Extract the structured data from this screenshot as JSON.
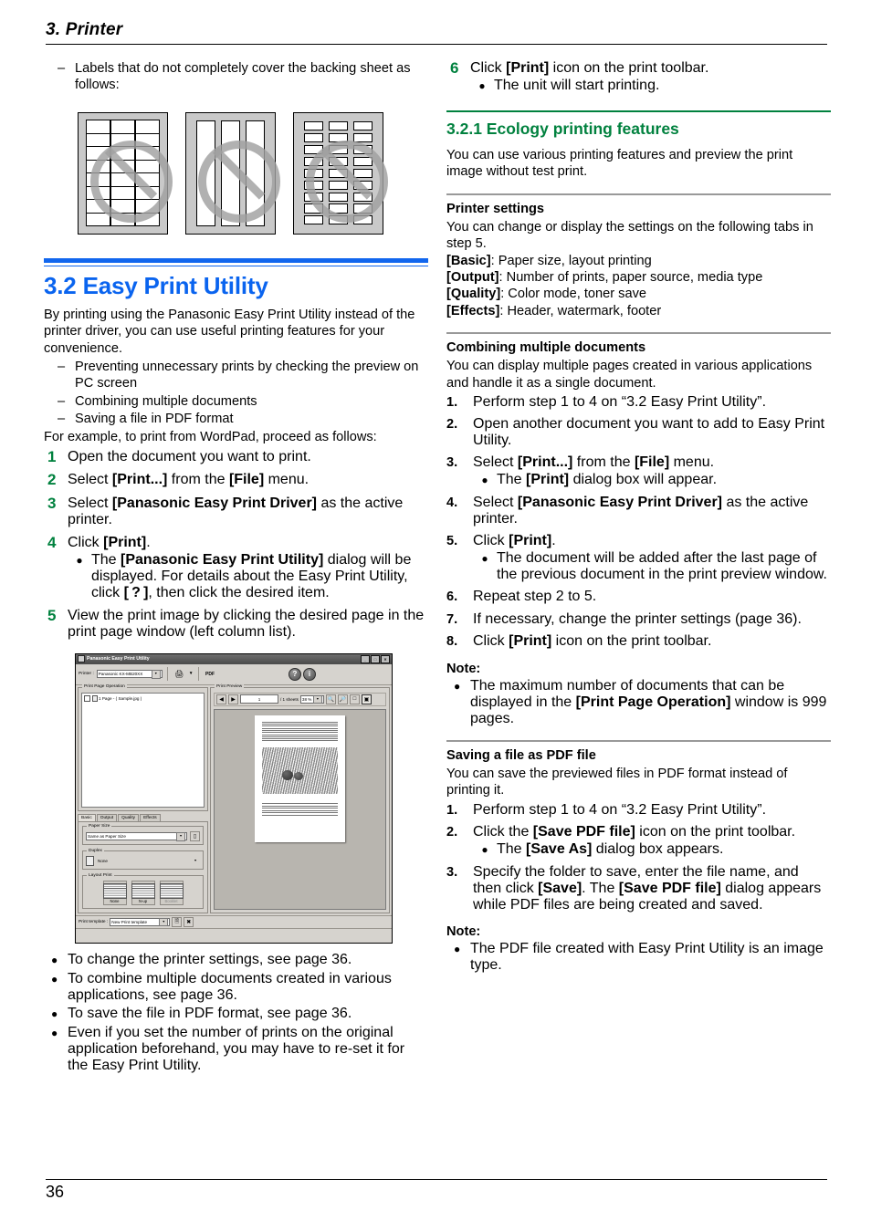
{
  "runhead": {
    "title": "3. Printer"
  },
  "left": {
    "dash_intro": "Labels that do not completely cover the backing sheet as follows:",
    "figures": [
      {
        "name": "grid-labels-figure"
      },
      {
        "name": "strip-labels-figure"
      },
      {
        "name": "small-labels-figure"
      }
    ],
    "heading": "3.2 Easy Print Utility",
    "intro": "By printing using the Panasonic Easy Print Utility instead of the printer driver, you can use useful printing features for your convenience.",
    "features": [
      "Preventing unnecessary prints by checking the preview on PC screen",
      "Combining multiple documents",
      "Saving a file in PDF format"
    ],
    "example_line": "For example, to print from WordPad, proceed as follows:",
    "steps": [
      {
        "num": "1",
        "text": "Open the document you want to print."
      },
      {
        "num": "2",
        "text": "Select [Print...] from the [File] menu."
      },
      {
        "num": "3",
        "text": "Select [Panasonic Easy Print Driver] as the active printer."
      },
      {
        "num": "4",
        "text": "Click [Print]."
      },
      {
        "num": "5",
        "text": "View the print image by clicking the desired page in the print page window (left column list)."
      }
    ],
    "step4_bullet": "The [Panasonic Easy Print Utility] dialog will be displayed. For details about the Easy Print Utility, click [ ? ], then click the desired item.",
    "after_bullets": [
      "To change the printer settings, see page 36.",
      "To combine multiple documents created in various applications, see page 36.",
      "To save the file in PDF format, see page 36.",
      "Even if you set the number of prints on the original application beforehand, you may have to re-set it for the Easy Print Utility."
    ]
  },
  "screenshot": {
    "window_title": "Panasonic Easy Print Utility",
    "title_buttons": [
      "_",
      "□",
      "✕"
    ],
    "printer_label": "Printer :",
    "printer_value": "Panasonic KX-MB20XX",
    "print_icon": "print-icon",
    "pdf_icon": "PDF",
    "help_icon": "?",
    "info_icon": "i",
    "left_group_title": "Print Page Operation",
    "tree_item": "1 Page - ( Sample.jpg )",
    "tabs": [
      "Basic",
      "Output",
      "Quality",
      "Effects"
    ],
    "active_tab": "Basic",
    "paper_size_title": "Paper Size",
    "paper_size_value": "Same as Paper Size",
    "duplex_title": "Duplex",
    "duplex_value": "None",
    "layout_title": "Layout Print",
    "layout_options": [
      "None",
      "N-up",
      "Booklet"
    ],
    "print_template_label": "Print template :",
    "print_template_value": "New Print template",
    "preview_group_title": "Print Preview",
    "page_number": "1",
    "page_total": "/  1 sheets",
    "zoom_value": "38 %"
  },
  "right": {
    "step6": {
      "num": "6",
      "text": "Click [Print] icon on the print toolbar."
    },
    "step6_bullet": "The unit will start printing.",
    "heading": "3.2.1 Ecology printing features",
    "intro": "You can use various printing features and preview the print image without test print.",
    "printer_settings": {
      "heading": "Printer settings",
      "intro": "You can change or display the settings on the following tabs in step 5.",
      "rows": [
        {
          "tab": "[Basic]",
          "desc": ": Paper size, layout printing"
        },
        {
          "tab": "[Output]",
          "desc": ": Number of prints, paper source, media type"
        },
        {
          "tab": "[Quality]",
          "desc": ": Color mode, toner save"
        },
        {
          "tab": "[Effects]",
          "desc": ": Header, watermark, footer"
        }
      ]
    },
    "combining": {
      "heading": "Combining multiple documents",
      "intro": "You can display multiple pages created in various applications and handle it as a single document.",
      "steps": [
        {
          "num": "1.",
          "text": "Perform step 1 to 4 on “3.2  Easy Print Utility”."
        },
        {
          "num": "2.",
          "text": "Open another document you want to add to Easy Print Utility."
        },
        {
          "num": "3.",
          "text": "Select [Print...] from the [File] menu."
        },
        {
          "num": "4.",
          "text": "Select [Panasonic Easy Print Driver] as the active printer."
        },
        {
          "num": "5.",
          "text": "Click [Print]."
        },
        {
          "num": "6.",
          "text": "Repeat step 2 to 5."
        },
        {
          "num": "7.",
          "text": "If necessary, change the printer settings (page 36)."
        },
        {
          "num": "8.",
          "text": "Click [Print] icon on the print toolbar."
        }
      ],
      "step3_bullet": "The [Print] dialog box will appear.",
      "step5_bullet": "The document will be added after the last page of the previous document in the print preview window.",
      "note_heading": "Note:",
      "note_bullet": "The maximum number of documents that can be displayed in the [Print Page Operation] window is 999 pages."
    },
    "saving_pdf": {
      "heading": "Saving a file as PDF file",
      "intro": "You can save the previewed files in PDF format instead of printing it.",
      "steps": [
        {
          "num": "1.",
          "text": "Perform step 1 to 4 on “3.2  Easy Print Utility”."
        },
        {
          "num": "2.",
          "text": "Click the [Save PDF file] icon on the print toolbar."
        },
        {
          "num": "3.",
          "text": "Specify the folder to save, enter the file name, and then click [Save]. The [Save PDF file] dialog appears while PDF files are being created and saved."
        }
      ],
      "step2_bullet": "The [Save As] dialog box appears.",
      "note_heading": "Note:",
      "note_bullet": "The PDF file created with Easy Print Utility is an image type."
    }
  },
  "footer": {
    "page_number": "36"
  },
  "colors": {
    "blue_heading": "#0a64ef",
    "green_heading": "#00813e",
    "gray_rule": "#999999"
  }
}
